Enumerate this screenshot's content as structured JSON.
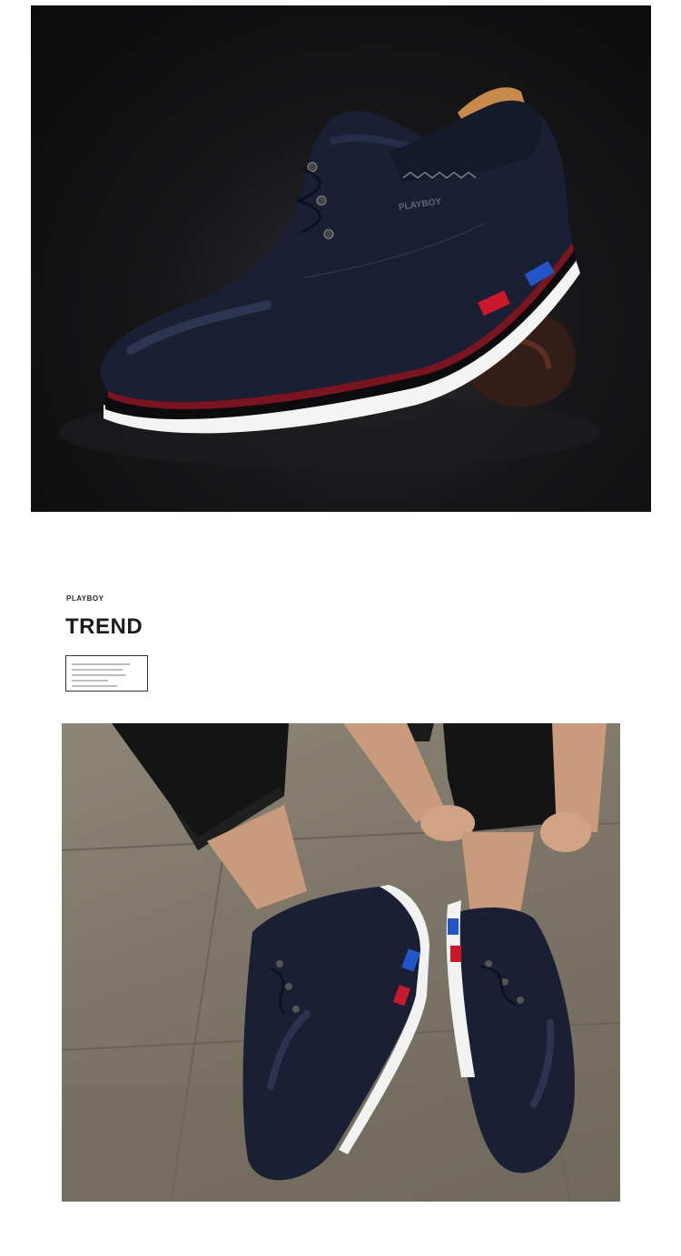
{
  "hero": {
    "shoe_logo": "PLAYBOY",
    "colors": {
      "background": "#111113",
      "leather": "#1a1f33",
      "sole_red": "#c8182a",
      "sole_blue": "#2255c8"
    }
  },
  "trend": {
    "brand": "PLAYBOY",
    "title": "TREND"
  },
  "lifestyle": {
    "colors": {
      "floor": "#7e7668",
      "pants": "#121212",
      "skin": "#c99a7b",
      "shoe": "#1a1f33"
    }
  }
}
